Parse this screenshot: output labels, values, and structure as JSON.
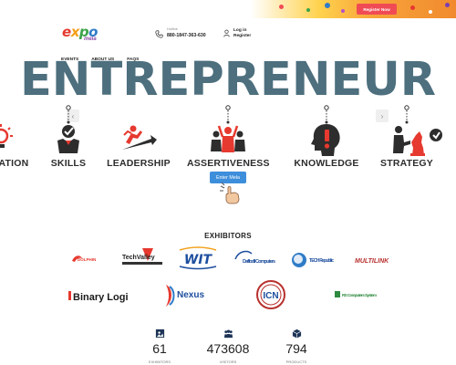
{
  "top_banner": {
    "register_label": "Register Now"
  },
  "header": {
    "logo": {
      "expo": "expo",
      "mela": "mela"
    },
    "hotline": {
      "label": "Hotline",
      "number": "880-1847-363-630"
    },
    "auth": {
      "login": "Log in",
      "register": "Register"
    }
  },
  "nav": {
    "items": [
      "EVENTS",
      "ABOUT US",
      "FAQS"
    ]
  },
  "hero": {
    "title": "ENTREPRENEUR",
    "skills": [
      "ATION",
      "SKILLS",
      "LEADERSHIP",
      "ASSERTIVENESS",
      "KNOWLEDGE",
      "STRATEGY"
    ],
    "enter_button": "Enter Mela",
    "prev_arrow": "‹",
    "next_arrow": "›"
  },
  "exhibitors": {
    "title": "EXHIBITORS",
    "logos": [
      "DOLPHIN",
      "TechValley",
      "WIT",
      "Daffodil Computers",
      "TECH Republic",
      "MULTILINK",
      "Binary Logi",
      "Nexus",
      "ICN",
      "RS Computers System"
    ]
  },
  "stats": [
    {
      "icon": "image-icon",
      "value": "61",
      "label": "EXHIBITORS"
    },
    {
      "icon": "users-icon",
      "value": "473608",
      "label": "VISITORS"
    },
    {
      "icon": "box-icon",
      "value": "794",
      "label": "PRODUCTS"
    }
  ],
  "colors": {
    "accent": "#f04b55",
    "hero_text": "#4d6f7e",
    "enter_button": "#3d8edb"
  }
}
